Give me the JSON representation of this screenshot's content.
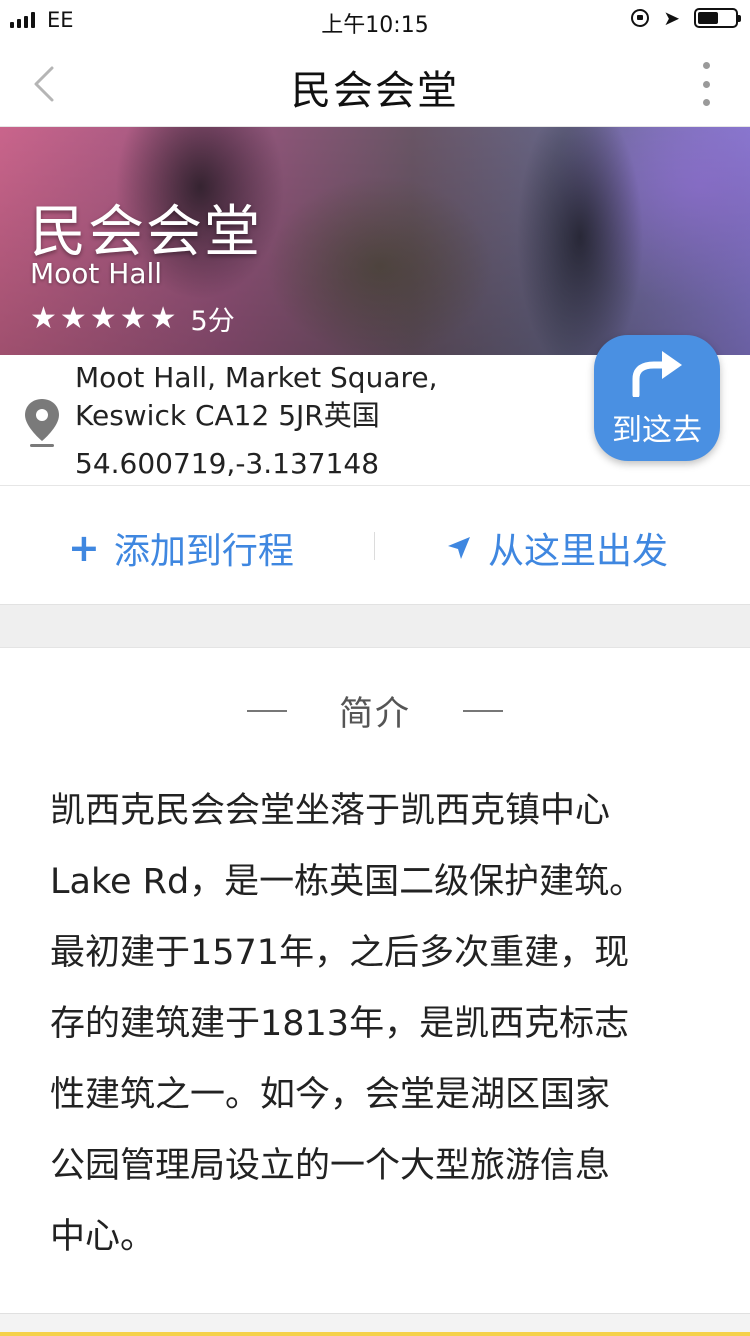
{
  "status_bar": {
    "carrier": "EE",
    "time": "上午10:15"
  },
  "nav": {
    "title": "民会会堂",
    "back_icon": "chevron-left-icon",
    "more_icon": "more-vertical-icon"
  },
  "hero": {
    "name": "民会会堂",
    "name_en": "Moot Hall",
    "rating_stars": 5,
    "score": "5分"
  },
  "address": {
    "text": "Moot Hall, Market Square,\nKeswick CA12 5JR英国",
    "coords": "54.600719,-3.137148",
    "go_button": "到这去"
  },
  "actions": {
    "add_plus": "+",
    "add_label": "添加到行程",
    "depart_label": "从这里出发"
  },
  "intro": {
    "title": "简介",
    "body": "凯西克民会会堂坐落于凯西克镇中心\nLake Rd，是一栋英国二级保护建筑。\n最初建于1571年，之后多次重建，现\n存的建筑建于1813年，是凯西克标志\n性建筑之一。如今，会堂是湖区国家\n公园管理局设立的一个大型旅游信息\n中心。"
  },
  "colors": {
    "accent": "#3f87e0",
    "go_button": "#4a90e2"
  }
}
